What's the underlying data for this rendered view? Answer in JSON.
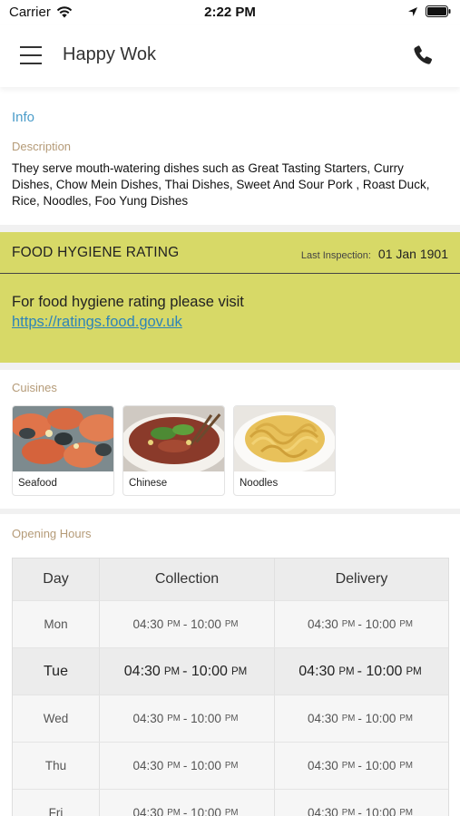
{
  "status_bar": {
    "carrier": "Carrier",
    "time": "2:22 PM"
  },
  "nav": {
    "title": "Happy Wok"
  },
  "info": {
    "header": "Info",
    "description_label": "Description",
    "description": "They serve mouth-watering dishes such as Great Tasting Starters, Curry Dishes, Chow Mein Dishes, Thai Dishes, Sweet And Sour Pork , Roast Duck, Rice, Noodles, Foo Yung Dishes"
  },
  "hygiene": {
    "title": "FOOD HYGIENE RATING",
    "last_inspection_label": "Last Inspection:",
    "last_inspection_date": "01 Jan 1901",
    "text": "For food hygiene rating please visit",
    "link": "https://ratings.food.gov.uk",
    "background_color": "#d7d967",
    "link_color": "#2e84b8"
  },
  "cuisines": {
    "label": "Cuisines",
    "items": [
      {
        "label": "Seafood"
      },
      {
        "label": "Chinese"
      },
      {
        "label": "Noodles"
      }
    ]
  },
  "hours": {
    "label": "Opening Hours",
    "columns": [
      "Day",
      "Collection",
      "Delivery"
    ],
    "rows": [
      {
        "day": "Mon",
        "c_open": "04:30",
        "c_open_ampm": "PM",
        "c_close": "10:00",
        "c_close_ampm": "PM",
        "d_open": "04:30",
        "d_open_ampm": "PM",
        "d_close": "10:00",
        "d_close_ampm": "PM"
      },
      {
        "day": "Tue",
        "c_open": "04:30",
        "c_open_ampm": "PM",
        "c_close": "10:00",
        "c_close_ampm": "PM",
        "d_open": "04:30",
        "d_open_ampm": "PM",
        "d_close": "10:00",
        "d_close_ampm": "PM"
      },
      {
        "day": "Wed",
        "c_open": "04:30",
        "c_open_ampm": "PM",
        "c_close": "10:00",
        "c_close_ampm": "PM",
        "d_open": "04:30",
        "d_open_ampm": "PM",
        "d_close": "10:00",
        "d_close_ampm": "PM"
      },
      {
        "day": "Thu",
        "c_open": "04:30",
        "c_open_ampm": "PM",
        "c_close": "10:00",
        "c_close_ampm": "PM",
        "d_open": "04:30",
        "d_open_ampm": "PM",
        "d_close": "10:00",
        "d_close_ampm": "PM"
      },
      {
        "day": "Fri",
        "c_open": "04:30",
        "c_open_ampm": "PM",
        "c_close": "10:00",
        "c_close_ampm": "PM",
        "d_open": "04:30",
        "d_open_ampm": "PM",
        "d_close": "10:00",
        "d_close_ampm": "PM"
      }
    ]
  },
  "colors": {
    "accent_info": "#4a9cc9",
    "label_tan": "#b59b78"
  }
}
